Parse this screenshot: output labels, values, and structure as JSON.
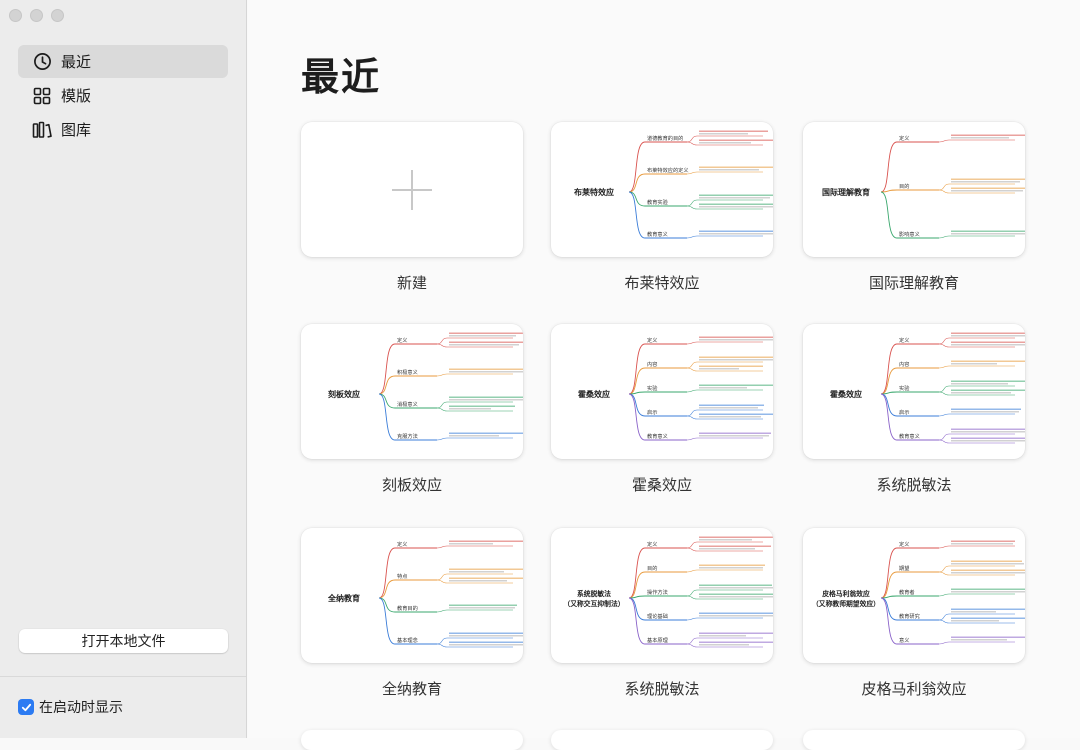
{
  "sidebar": {
    "items": [
      {
        "label": "最近",
        "icon": "clock-icon",
        "active": true
      },
      {
        "label": "模版",
        "icon": "grid-icon",
        "active": false
      },
      {
        "label": "图库",
        "icon": "library-icon",
        "active": false
      }
    ],
    "open_local_file": "打开本地文件",
    "show_on_startup": "在启动时显示",
    "show_on_startup_checked": true
  },
  "main": {
    "title": "最近",
    "files": [
      {
        "name": "新建",
        "type": "new"
      },
      {
        "name": "布莱特效应",
        "root": "布莱特效应",
        "branches": [
          "道德教育的目的",
          "布莱特效应的定义",
          "教育实验",
          "教育意义"
        ]
      },
      {
        "name": "国际理解教育",
        "root": "国际理解教育",
        "branches": [
          "定义",
          "目的",
          "影响意义"
        ]
      },
      {
        "name": "刻板效应",
        "root": "刻板效应",
        "branches": [
          "定义",
          "积极意义",
          "消极意义",
          "克服方法"
        ]
      },
      {
        "name": "霍桑效应",
        "root": "霍桑效应",
        "branches": [
          "定义",
          "内容",
          "实验",
          "启示",
          "教育意义"
        ]
      },
      {
        "name": "系统脱敏法",
        "root": "霍桑效应",
        "branches": [
          "定义",
          "内容",
          "实验",
          "启示",
          "教育意义"
        ]
      },
      {
        "name": "全纳教育",
        "root": "全纳教育",
        "branches": [
          "定义",
          "特点",
          "教育目的",
          "基本理念"
        ]
      },
      {
        "name": "系统脱敏法",
        "root": "系统脱敏法\n（又称交互抑制法）",
        "branches": [
          "定义",
          "目的",
          "操作方法",
          "理论基础",
          "基本原理"
        ]
      },
      {
        "name": "皮格马利翁效应",
        "root": "皮格马利翁效应\n（又称教师期望效应）",
        "branches": [
          "定义",
          "期望",
          "教育者",
          "教育研究",
          "意义"
        ]
      }
    ]
  },
  "colors": {
    "accent": "#2c7bf2",
    "branch_palette": [
      "#d9534f",
      "#e89a3c",
      "#3aa76d",
      "#3b7dd8",
      "#8a63c9"
    ]
  }
}
